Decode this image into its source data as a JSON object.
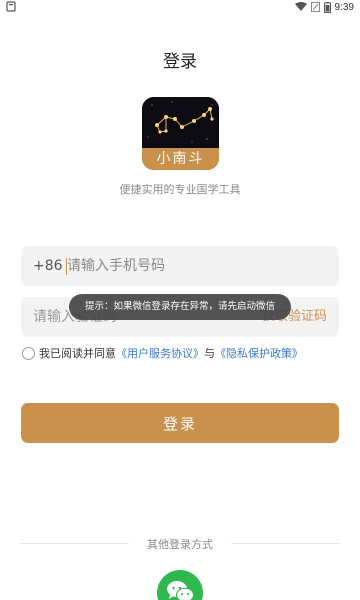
{
  "status_bar": {
    "time": "9:39",
    "icons": [
      "app-notification-icon",
      "wifi-icon",
      "signal-icon",
      "battery-icon"
    ]
  },
  "header": {
    "title": "登录"
  },
  "app": {
    "logo_text": "小南斗",
    "tagline": "便捷实用的专业国学工具"
  },
  "phone": {
    "prefix": "+86",
    "placeholder": "请输入手机号码"
  },
  "code": {
    "placeholder": "请输入验证码",
    "get_code_label": "获取验证码"
  },
  "agreement": {
    "text": "我已阅读并同意",
    "user_agreement": "《用户服务协议》",
    "and": "与",
    "privacy_policy": "《隐私保护政策》"
  },
  "login_button": "登录",
  "toast": "提示：如果微信登录存在异常，请先启动微信",
  "other_login": {
    "label": "其他登录方式",
    "methods": [
      "wechat-icon"
    ]
  },
  "colors": {
    "accent": "#c9914c",
    "link": "#3b79c9",
    "wechat": "#2fb84e"
  }
}
